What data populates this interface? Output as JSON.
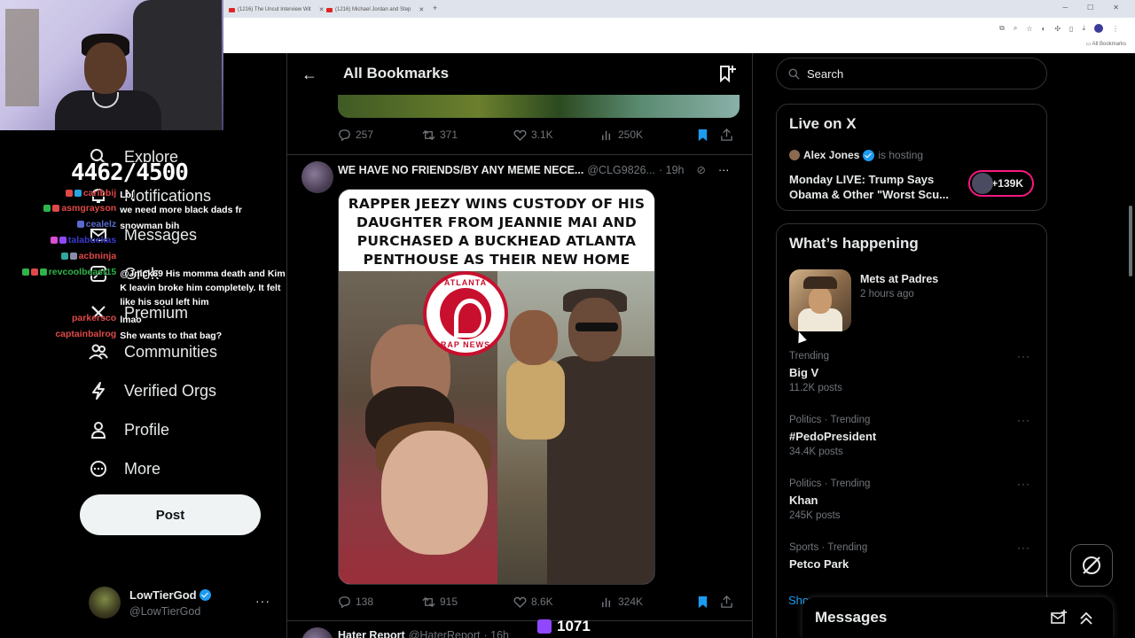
{
  "browser": {
    "tabs": [
      {
        "label": "(1216) The Uncut Interview Wit"
      },
      {
        "label": "(1216) Michael Jordan and Step"
      }
    ],
    "new_tab": "+",
    "bookmarks_bar": "All Bookmarks"
  },
  "overlay": {
    "sub_counter": "4462/4500",
    "chat": [
      {
        "user": "caribbij",
        "text": "Lol",
        "color": "#e04848"
      },
      {
        "user": "asmgrayson",
        "text": "we need more black dads fr",
        "color": "#e04848"
      },
      {
        "user": "cealelz",
        "text": "snowman bih",
        "color": "#5a6acf"
      },
      {
        "user": "talabuckas",
        "text": "",
        "color": "#3a3ad0"
      },
      {
        "user": "acbninja",
        "text": "",
        "color": "#e04848"
      },
      {
        "user": "revcoolbeast15",
        "text": "@Jnick69 His momma death and Kim K leavin broke him completely. It felt like his soul left him",
        "color": "#2fb34a"
      },
      {
        "user": "parkersco",
        "text": "lmao",
        "color": "#e04848"
      },
      {
        "user": "captainbalrog",
        "text": "She wants to that bag?",
        "color": "#e04848"
      }
    ],
    "bits": "1071"
  },
  "nav": {
    "items": [
      {
        "label": "Explore",
        "icon": "search-icon"
      },
      {
        "label": "Notifications",
        "icon": "bell-icon"
      },
      {
        "label": "Messages",
        "icon": "envelope-icon"
      },
      {
        "label": "Grok",
        "icon": "grok-icon"
      },
      {
        "label": "Premium",
        "icon": "x-logo-icon"
      },
      {
        "label": "Communities",
        "icon": "people-icon"
      },
      {
        "label": "Verified Orgs",
        "icon": "lightning-icon"
      },
      {
        "label": "Profile",
        "icon": "person-icon"
      },
      {
        "label": "More",
        "icon": "more-circle-icon"
      }
    ],
    "post_label": "Post"
  },
  "account": {
    "name": "LowTierGod",
    "handle": "@LowTierGod",
    "more": "···"
  },
  "main": {
    "title": "All Bookmarks",
    "prev_tweet_actions": {
      "replies": "257",
      "reposts": "371",
      "likes": "3.1K",
      "views": "250K"
    },
    "tweet": {
      "author": "WE HAVE NO FRIENDS/BY ANY MEME NECE...",
      "handle": "@CLG9826...",
      "time": "· 19h",
      "headline": "RAPPER JEEZY WINS CUSTODY OF HIS DAUGHTER FROM JEANNIE MAI AND PURCHASED A BUCKHEAD ATLANTA PENTHOUSE AS THEIR NEW HOME",
      "logo_text_top": "ATLANTA",
      "logo_text_bottom": "RAP NEWS",
      "actions": {
        "replies": "138",
        "reposts": "915",
        "likes": "8.6K",
        "views": "324K"
      }
    },
    "next_tweet": {
      "author": "Hater Report",
      "handle": "@HaterReport",
      "time": "· 16h"
    }
  },
  "right": {
    "search_placeholder": "Search",
    "live": {
      "header": "Live on X",
      "host": "Alex Jones",
      "host_suffix": "is hosting",
      "title": "Monday LIVE: Trump Says Obama & Other \"Worst Scu...",
      "count": "+139K",
      "accent": "#f91880"
    },
    "happening": {
      "header": "What’s happening",
      "featured": {
        "title": "Mets at Padres",
        "time": "2 hours ago"
      },
      "trends": [
        {
          "meta": "Trending",
          "name": "Big V",
          "count": "11.2K posts"
        },
        {
          "meta": "Politics · Trending",
          "name": "#PedoPresident",
          "count": "34.4K posts"
        },
        {
          "meta": "Politics · Trending",
          "name": "Khan",
          "count": "245K posts"
        },
        {
          "meta": "Sports · Trending",
          "name": "Petco Park",
          "count": ""
        }
      ],
      "show_more": "Show more"
    },
    "messages_drawer": "Messages"
  },
  "colors": {
    "accent": "#1d9bf0",
    "bookmark": "#1d9bf0",
    "background": "#000000"
  }
}
